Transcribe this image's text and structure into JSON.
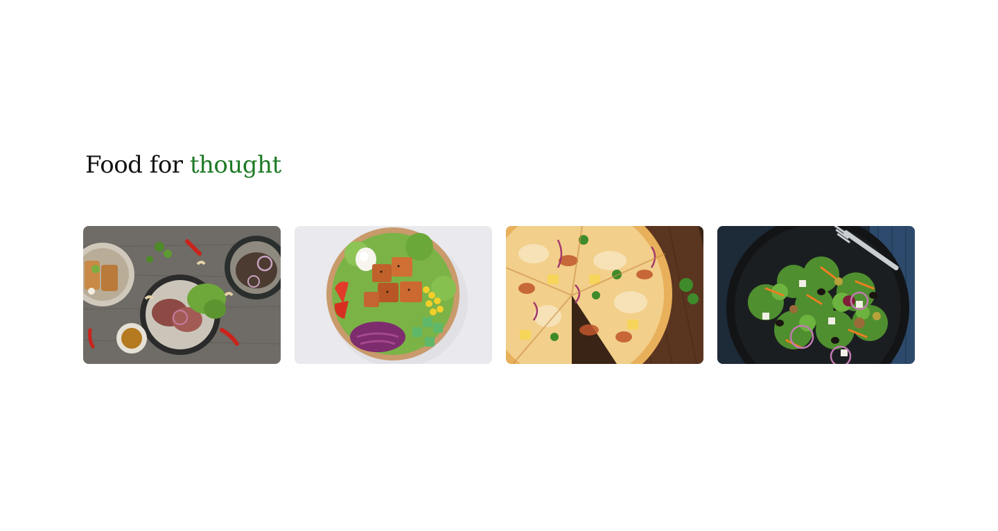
{
  "heading": {
    "prefix": "Food for",
    "accent": "thought",
    "accent_color": "#1d7a25"
  },
  "gallery": {
    "cards": [
      {
        "name": "food-photo-plates",
        "subject": "steak, salad and quinoa plates on wooden table"
      },
      {
        "name": "food-photo-bowl",
        "subject": "salmon, egg, corn and vegetable salad bowl"
      },
      {
        "name": "food-photo-pizza",
        "subject": "sliced pizza on wooden board"
      },
      {
        "name": "food-photo-salad",
        "subject": "green salad on dark plate with fork"
      }
    ]
  }
}
